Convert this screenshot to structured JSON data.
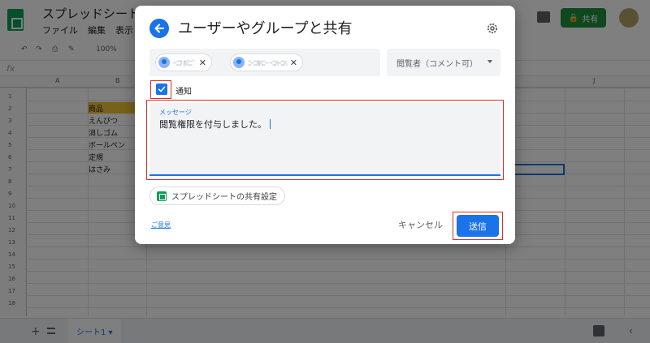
{
  "app": {
    "doc_title": "スプレッドシートの",
    "menus": [
      "ファイル",
      "編集",
      "表示"
    ],
    "share_label": "共有",
    "zoom": "100%"
  },
  "sheet": {
    "columns": [
      "A",
      "B",
      "J"
    ],
    "rows": [
      "1",
      "2",
      "3",
      "4",
      "5",
      "6",
      "7",
      "8",
      "9",
      "10",
      "11",
      "12",
      "13",
      "14",
      "15",
      "16",
      "17",
      "18"
    ],
    "cells": [
      "商品",
      "えんぴつ",
      "消しゴム",
      "ボールペン",
      "定規",
      "はさみ"
    ],
    "tab_name": "シート1"
  },
  "dialog": {
    "title": "ユーザーやグループと共有",
    "recipients": [
      {
        "name": "ｰﾆﾌ ﾎﾐﾆﾟ"
      },
      {
        "name": "ﾆｰﾆﾎﾊﾆｰ ｰﾆﾊｰﾆﾊ"
      }
    ],
    "role": "閲覧者（コメント可）",
    "notify_label": "通知",
    "notify_checked": true,
    "message_label": "メッセージ",
    "message_text": "閲覧権限を付与しました。",
    "sheet_settings_label": "スプレッドシートの共有設定",
    "feedback_label": "ご意見",
    "cancel_label": "キャンセル",
    "send_label": "送信"
  },
  "colors": {
    "accent": "#1a73e8",
    "highlight_frame": "#d93025",
    "share_green": "#1e8e3e",
    "header_cell": "#f1c232"
  }
}
